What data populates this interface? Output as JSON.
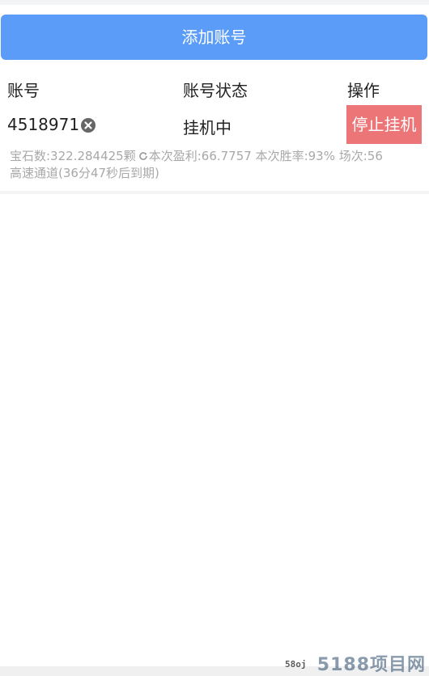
{
  "add_button": {
    "label": "添加账号"
  },
  "table": {
    "headers": {
      "account": "账号",
      "status": "账号状态",
      "action": "操作"
    },
    "rows": [
      {
        "account": "4518971",
        "status": "挂机中",
        "action_label": "停止挂机",
        "info_line1_a": "宝石数:322.284425颗",
        "info_line1_b": "本次盈利:66.7757 本次胜率:93% 场次:56",
        "info_line2": "高速通道(36分47秒后到期)"
      }
    ]
  },
  "watermark": {
    "main": "5188项目网",
    "small": "58oj"
  },
  "colors": {
    "add_button_bg": "#5a9cf8",
    "stop_button_bg": "#ec7577",
    "info_text": "#a8a8a8"
  },
  "icons": {
    "remove": "circle-x-icon",
    "refresh": "refresh-icon"
  }
}
